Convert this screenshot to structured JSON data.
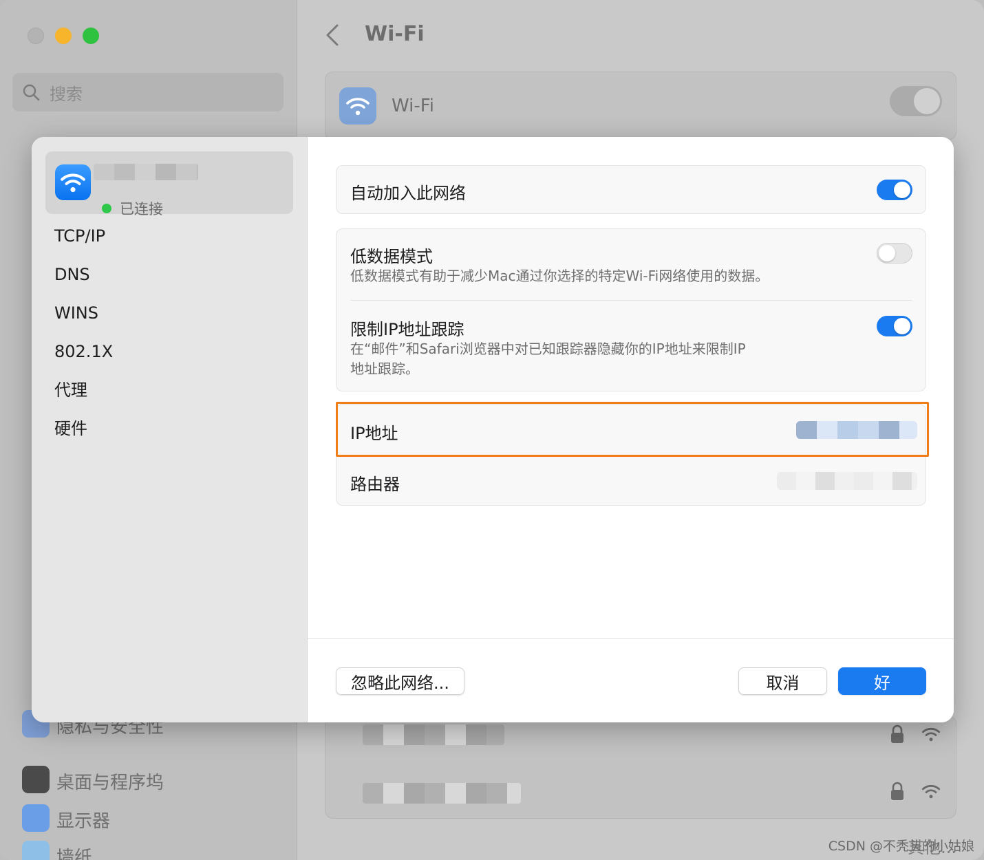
{
  "background": {
    "search_placeholder": "搜索",
    "title": "Wi-Fi",
    "wifi_card_label": "Wi-Fi",
    "sidebar_items": [
      {
        "label": "隐私与安全性",
        "icon": "hand-icon",
        "color": "#5d8ad8"
      },
      {
        "label": "桌面与程序坞",
        "icon": "dock-icon",
        "color": "#3a3a3a"
      },
      {
        "label": "显示器",
        "icon": "sun-icon",
        "color": "#4a8ef0"
      },
      {
        "label": "墙纸",
        "icon": "flower-icon",
        "color": "#6bb3e8"
      }
    ],
    "other_button": "其他...",
    "watermark": "CSDN @不秃头的小姑娘"
  },
  "sheet": {
    "network": {
      "status": "已连接",
      "icon": "wifi-icon",
      "status_color": "#2ec84a"
    },
    "nav": [
      "TCP/IP",
      "DNS",
      "WINS",
      "802.1X",
      "代理",
      "硬件"
    ],
    "auto_join": {
      "title": "自动加入此网络",
      "on": true
    },
    "low_data": {
      "title": "低数据模式",
      "desc": "低数据模式有助于减少Mac通过你选择的特定Wi-Fi网络使用的数据。",
      "on": false
    },
    "limit_ip": {
      "title": "限制IP地址跟踪",
      "desc_line1": "在“邮件”和Safari浏览器中对已知跟踪器隐藏你的IP地址来限制IP",
      "desc_line2": "地址跟踪。",
      "on": true
    },
    "ip_address": {
      "label": "IP地址"
    },
    "router": {
      "label": "路由器"
    },
    "buttons": {
      "ignore": "忽略此网络...",
      "cancel": "取消",
      "ok": "好"
    },
    "accent_color": "#1a7bf0",
    "highlight_color": "#f07d17"
  }
}
